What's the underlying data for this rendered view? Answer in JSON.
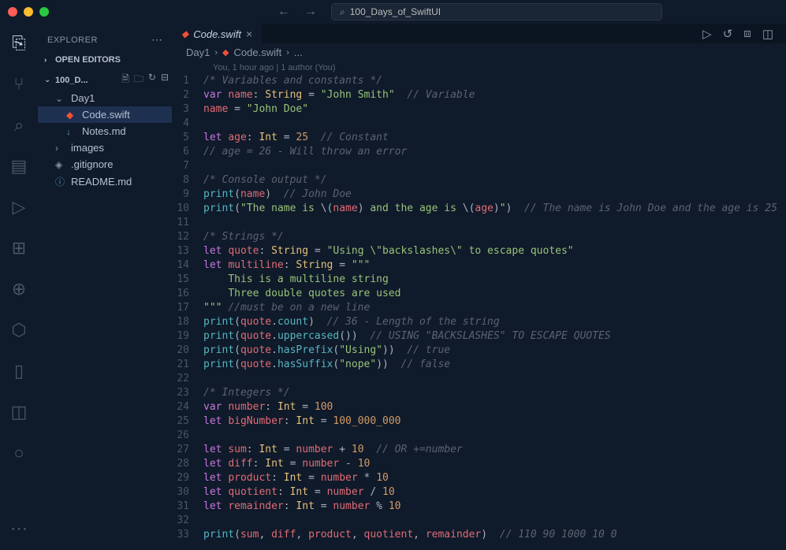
{
  "titlebar": {
    "search_value": "100_Days_of_SwiftUI"
  },
  "sidebar": {
    "title": "EXPLORER",
    "open_editors": "OPEN EDITORS",
    "root": "100_D...",
    "items": [
      {
        "label": "Day1",
        "type": "folder",
        "indent": 1
      },
      {
        "label": "Code.swift",
        "type": "swift",
        "indent": 2,
        "active": true
      },
      {
        "label": "Notes.md",
        "type": "md",
        "indent": 2
      },
      {
        "label": "images",
        "type": "folder-closed",
        "indent": 1
      },
      {
        "label": ".gitignore",
        "type": "git",
        "indent": 1
      },
      {
        "label": "README.md",
        "type": "info",
        "indent": 1
      }
    ]
  },
  "tab": {
    "label": "Code.swift"
  },
  "breadcrumb": {
    "parts": [
      "Day1",
      "Code.swift",
      "..."
    ]
  },
  "gitlens": "You, 1 hour ago | 1 author (You)",
  "code": {
    "lines": [
      {
        "n": 1,
        "tokens": [
          [
            "cm",
            "/* Variables and constants */"
          ]
        ]
      },
      {
        "n": 2,
        "tokens": [
          [
            "kw",
            "var"
          ],
          [
            "dft",
            " "
          ],
          [
            "id",
            "name"
          ],
          [
            "pn",
            ": "
          ],
          [
            "ty",
            "String"
          ],
          [
            "pn",
            " = "
          ],
          [
            "st",
            "\"John Smith\""
          ],
          [
            "dft",
            "  "
          ],
          [
            "cm",
            "// Variable"
          ]
        ]
      },
      {
        "n": 3,
        "tokens": [
          [
            "id",
            "name"
          ],
          [
            "pn",
            " = "
          ],
          [
            "st",
            "\"John Doe\""
          ]
        ]
      },
      {
        "n": 4,
        "tokens": []
      },
      {
        "n": 5,
        "tokens": [
          [
            "kw",
            "let"
          ],
          [
            "dft",
            " "
          ],
          [
            "id",
            "age"
          ],
          [
            "pn",
            ": "
          ],
          [
            "ty",
            "Int"
          ],
          [
            "pn",
            " = "
          ],
          [
            "nm",
            "25"
          ],
          [
            "dft",
            "  "
          ],
          [
            "cm",
            "// Constant"
          ]
        ]
      },
      {
        "n": 6,
        "tokens": [
          [
            "cm",
            "// age = 26 - Will throw an error"
          ]
        ]
      },
      {
        "n": 7,
        "tokens": []
      },
      {
        "n": 8,
        "tokens": [
          [
            "cm",
            "/* Console output */"
          ]
        ]
      },
      {
        "n": 9,
        "tokens": [
          [
            "fn",
            "print"
          ],
          [
            "pn",
            "("
          ],
          [
            "id",
            "name"
          ],
          [
            "pn",
            ")"
          ],
          [
            "dft",
            "  "
          ],
          [
            "cm",
            "// John Doe"
          ]
        ]
      },
      {
        "n": 10,
        "tokens": [
          [
            "fn",
            "print"
          ],
          [
            "pn",
            "("
          ],
          [
            "st",
            "\"The name is "
          ],
          [
            "pn",
            "\\("
          ],
          [
            "id",
            "name"
          ],
          [
            "pn",
            ")"
          ],
          [
            "st",
            " and the age is "
          ],
          [
            "pn",
            "\\("
          ],
          [
            "id",
            "age"
          ],
          [
            "pn",
            ")"
          ],
          [
            "st",
            "\""
          ],
          [
            "pn",
            ")"
          ],
          [
            "dft",
            "  "
          ],
          [
            "cm",
            "// The name is John Doe and the age is 25"
          ]
        ]
      },
      {
        "n": 11,
        "tokens": []
      },
      {
        "n": 12,
        "tokens": [
          [
            "cm",
            "/* Strings */"
          ]
        ]
      },
      {
        "n": 13,
        "tokens": [
          [
            "kw",
            "let"
          ],
          [
            "dft",
            " "
          ],
          [
            "id",
            "quote"
          ],
          [
            "pn",
            ": "
          ],
          [
            "ty",
            "String"
          ],
          [
            "pn",
            " = "
          ],
          [
            "st",
            "\"Using \\\"backslashes\\\" to escape quotes\""
          ]
        ]
      },
      {
        "n": 14,
        "tokens": [
          [
            "kw",
            "let"
          ],
          [
            "dft",
            " "
          ],
          [
            "id",
            "multiline"
          ],
          [
            "pn",
            ": "
          ],
          [
            "ty",
            "String"
          ],
          [
            "pn",
            " = "
          ],
          [
            "st",
            "\"\"\""
          ]
        ]
      },
      {
        "n": 15,
        "tokens": [
          [
            "dft",
            "    "
          ],
          [
            "st",
            "This is a multiline string"
          ]
        ]
      },
      {
        "n": 16,
        "tokens": [
          [
            "dft",
            "    "
          ],
          [
            "st",
            "Three double quotes are used"
          ]
        ]
      },
      {
        "n": 17,
        "tokens": [
          [
            "st",
            "\"\"\""
          ],
          [
            "dft",
            " "
          ],
          [
            "cm",
            "//must be on a new line"
          ]
        ]
      },
      {
        "n": 18,
        "tokens": [
          [
            "fn",
            "print"
          ],
          [
            "pn",
            "("
          ],
          [
            "id",
            "quote"
          ],
          [
            "pn",
            "."
          ],
          [
            "fn",
            "count"
          ],
          [
            "pn",
            ")"
          ],
          [
            "dft",
            "  "
          ],
          [
            "cm",
            "// 36 - Length of the string"
          ]
        ]
      },
      {
        "n": 19,
        "tokens": [
          [
            "fn",
            "print"
          ],
          [
            "pn",
            "("
          ],
          [
            "id",
            "quote"
          ],
          [
            "pn",
            "."
          ],
          [
            "fn",
            "uppercased"
          ],
          [
            "pn",
            "())"
          ],
          [
            "dft",
            "  "
          ],
          [
            "cm",
            "// USING \"BACKSLASHES\" TO ESCAPE QUOTES"
          ]
        ]
      },
      {
        "n": 20,
        "tokens": [
          [
            "fn",
            "print"
          ],
          [
            "pn",
            "("
          ],
          [
            "id",
            "quote"
          ],
          [
            "pn",
            "."
          ],
          [
            "fn",
            "hasPrefix"
          ],
          [
            "pn",
            "("
          ],
          [
            "st",
            "\"Using\""
          ],
          [
            "pn",
            "))"
          ],
          [
            "dft",
            "  "
          ],
          [
            "cm",
            "// true"
          ]
        ]
      },
      {
        "n": 21,
        "tokens": [
          [
            "fn",
            "print"
          ],
          [
            "pn",
            "("
          ],
          [
            "id",
            "quote"
          ],
          [
            "pn",
            "."
          ],
          [
            "fn",
            "hasSuffix"
          ],
          [
            "pn",
            "("
          ],
          [
            "st",
            "\"nope\""
          ],
          [
            "pn",
            "))"
          ],
          [
            "dft",
            "  "
          ],
          [
            "cm",
            "// false"
          ]
        ]
      },
      {
        "n": 22,
        "tokens": []
      },
      {
        "n": 23,
        "tokens": [
          [
            "cm",
            "/* Integers */"
          ]
        ]
      },
      {
        "n": 24,
        "tokens": [
          [
            "kw",
            "var"
          ],
          [
            "dft",
            " "
          ],
          [
            "id",
            "number"
          ],
          [
            "pn",
            ": "
          ],
          [
            "ty",
            "Int"
          ],
          [
            "pn",
            " = "
          ],
          [
            "nm",
            "100"
          ]
        ]
      },
      {
        "n": 25,
        "tokens": [
          [
            "kw",
            "let"
          ],
          [
            "dft",
            " "
          ],
          [
            "id",
            "bigNumber"
          ],
          [
            "pn",
            ": "
          ],
          [
            "ty",
            "Int"
          ],
          [
            "pn",
            " = "
          ],
          [
            "nm",
            "100_000_000"
          ]
        ]
      },
      {
        "n": 26,
        "tokens": []
      },
      {
        "n": 27,
        "tokens": [
          [
            "kw",
            "let"
          ],
          [
            "dft",
            " "
          ],
          [
            "id",
            "sum"
          ],
          [
            "pn",
            ": "
          ],
          [
            "ty",
            "Int"
          ],
          [
            "pn",
            " = "
          ],
          [
            "id",
            "number"
          ],
          [
            "pn",
            " + "
          ],
          [
            "nm",
            "10"
          ],
          [
            "dft",
            "  "
          ],
          [
            "cm",
            "// OR +=number"
          ]
        ]
      },
      {
        "n": 28,
        "tokens": [
          [
            "kw",
            "let"
          ],
          [
            "dft",
            " "
          ],
          [
            "id",
            "diff"
          ],
          [
            "pn",
            ": "
          ],
          [
            "ty",
            "Int"
          ],
          [
            "pn",
            " = "
          ],
          [
            "id",
            "number"
          ],
          [
            "pn",
            " - "
          ],
          [
            "nm",
            "10"
          ]
        ]
      },
      {
        "n": 29,
        "tokens": [
          [
            "kw",
            "let"
          ],
          [
            "dft",
            " "
          ],
          [
            "id",
            "product"
          ],
          [
            "pn",
            ": "
          ],
          [
            "ty",
            "Int"
          ],
          [
            "pn",
            " = "
          ],
          [
            "id",
            "number"
          ],
          [
            "pn",
            " * "
          ],
          [
            "nm",
            "10"
          ]
        ]
      },
      {
        "n": 30,
        "tokens": [
          [
            "kw",
            "let"
          ],
          [
            "dft",
            " "
          ],
          [
            "id",
            "quotient"
          ],
          [
            "pn",
            ": "
          ],
          [
            "ty",
            "Int"
          ],
          [
            "pn",
            " = "
          ],
          [
            "id",
            "number"
          ],
          [
            "pn",
            " / "
          ],
          [
            "nm",
            "10"
          ]
        ]
      },
      {
        "n": 31,
        "tokens": [
          [
            "kw",
            "let"
          ],
          [
            "dft",
            " "
          ],
          [
            "id",
            "remainder"
          ],
          [
            "pn",
            ": "
          ],
          [
            "ty",
            "Int"
          ],
          [
            "pn",
            " = "
          ],
          [
            "id",
            "number"
          ],
          [
            "pn",
            " % "
          ],
          [
            "nm",
            "10"
          ]
        ]
      },
      {
        "n": 32,
        "tokens": []
      },
      {
        "n": 33,
        "tokens": [
          [
            "fn",
            "print"
          ],
          [
            "pn",
            "("
          ],
          [
            "id",
            "sum"
          ],
          [
            "pn",
            ", "
          ],
          [
            "id",
            "diff"
          ],
          [
            "pn",
            ", "
          ],
          [
            "id",
            "product"
          ],
          [
            "pn",
            ", "
          ],
          [
            "id",
            "quotient"
          ],
          [
            "pn",
            ", "
          ],
          [
            "id",
            "remainder"
          ],
          [
            "pn",
            ")"
          ],
          [
            "dft",
            "  "
          ],
          [
            "cm",
            "// 110 90 1000 10 0"
          ]
        ]
      }
    ]
  }
}
